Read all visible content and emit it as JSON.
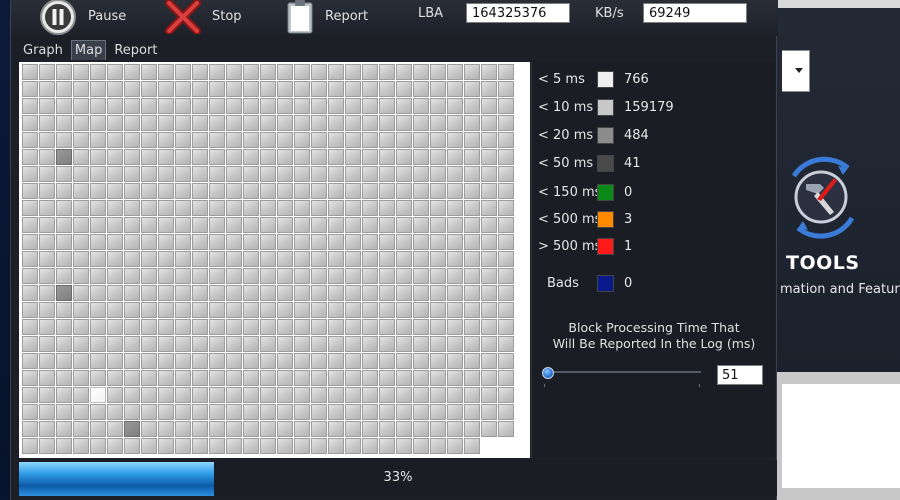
{
  "toolbar": {
    "pause_label": "Pause",
    "stop_label": "Stop",
    "report_label": "Report",
    "lba_label": "LBA",
    "lba_value": "164325376",
    "kbs_label": "KB/s",
    "kbs_value": "69249"
  },
  "tabs": [
    {
      "label": "Graph",
      "active": false
    },
    {
      "label": "Map",
      "active": true
    },
    {
      "label": "Report",
      "active": false
    }
  ],
  "legend": [
    {
      "label": "< 5 ms",
      "color": "#eeeeee",
      "count": "766"
    },
    {
      "label": "< 10 ms",
      "color": "#c8c8c8",
      "count": "159179"
    },
    {
      "label": "< 20 ms",
      "color": "#8c8c8c",
      "count": "484"
    },
    {
      "label": "< 50 ms",
      "color": "#4a4a4a",
      "count": "41"
    },
    {
      "label": "< 150 ms",
      "color": "#0b8a1a",
      "count": "0"
    },
    {
      "label": "< 500 ms",
      "color": "#ff8a00",
      "count": "3"
    },
    {
      "label": "> 500 ms",
      "color": "#ff1a1a",
      "count": "1"
    },
    {
      "label": "Bads",
      "color": "#0a1a8a",
      "count": "0"
    }
  ],
  "threshold": {
    "caption_line1": "Block Processing Time That",
    "caption_line2": "Will Be Reported In the Log (ms)",
    "value": "51"
  },
  "progress": {
    "text": "33%",
    "fraction": 0.33
  },
  "background_window": {
    "tools_label": "TOOLS",
    "tools_sub": "mation and Features"
  }
}
